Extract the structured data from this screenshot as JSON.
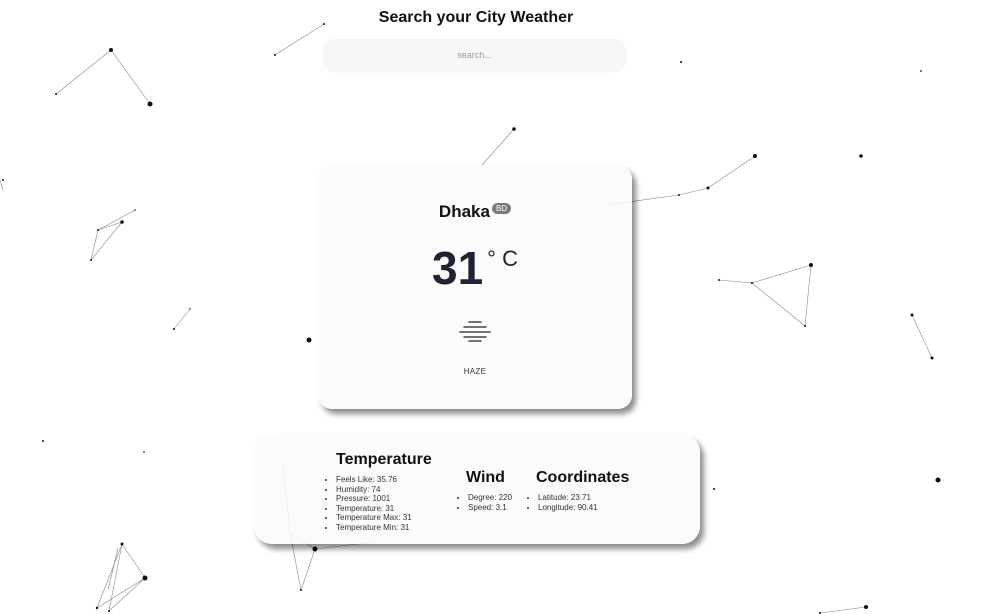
{
  "header": {
    "title": "Search your City Weather"
  },
  "search": {
    "placeholder": "search..."
  },
  "weather": {
    "city": "Dhaka",
    "country": "BD",
    "temperature": "31",
    "unit": "° C",
    "condition": "HAZE",
    "condition_icon": "haze-icon"
  },
  "details": {
    "temperature": {
      "title": "Temperature",
      "items": [
        "Feels Like: 35.76",
        "Humidity: 74",
        "Pressure: 1001",
        "Temperature: 31",
        "Temperature Max: 31",
        "Temperature Min: 31"
      ]
    },
    "wind": {
      "title": "Wind",
      "items": [
        "Degree: 220",
        "Speed: 3.1"
      ]
    },
    "coordinates": {
      "title": "Coordinates",
      "items": [
        "Latitude: 23.71",
        "Longitude: 90.41"
      ]
    }
  },
  "colors": {
    "background": "#ffffff",
    "card": "#fafafa",
    "temperature_text": "#1e2233",
    "badge": "#7a7a7a"
  }
}
